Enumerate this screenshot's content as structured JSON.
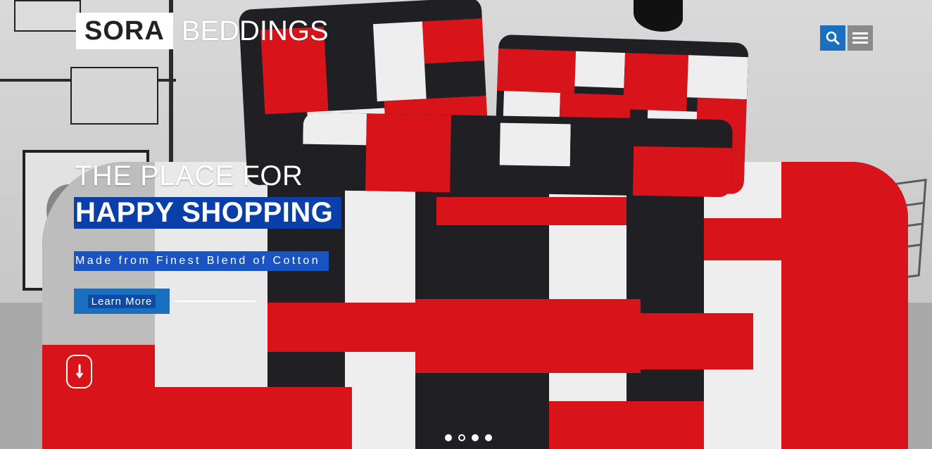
{
  "brand": {
    "box_text": "SORA",
    "text": "BEDDINGS"
  },
  "header": {
    "search_icon": "search-icon",
    "menu_icon": "hamburger-menu-icon"
  },
  "hero": {
    "headline_line1": "THE PLACE FOR",
    "headline_line2": "HAPPY SHOPPING",
    "tagline": "Made from Finest Blend of Cotton",
    "cta_label": "Learn More",
    "scroll_icon": "arrow-down-icon"
  },
  "slider": {
    "total_slides": 4,
    "active_index": 2
  },
  "colors": {
    "accent_blue": "#1a6fbf",
    "headline_highlight": "#0a3ea8",
    "bedding_red": "#d8141a",
    "bedding_dark": "#1f1f24",
    "bedding_white": "#eeeeee"
  }
}
